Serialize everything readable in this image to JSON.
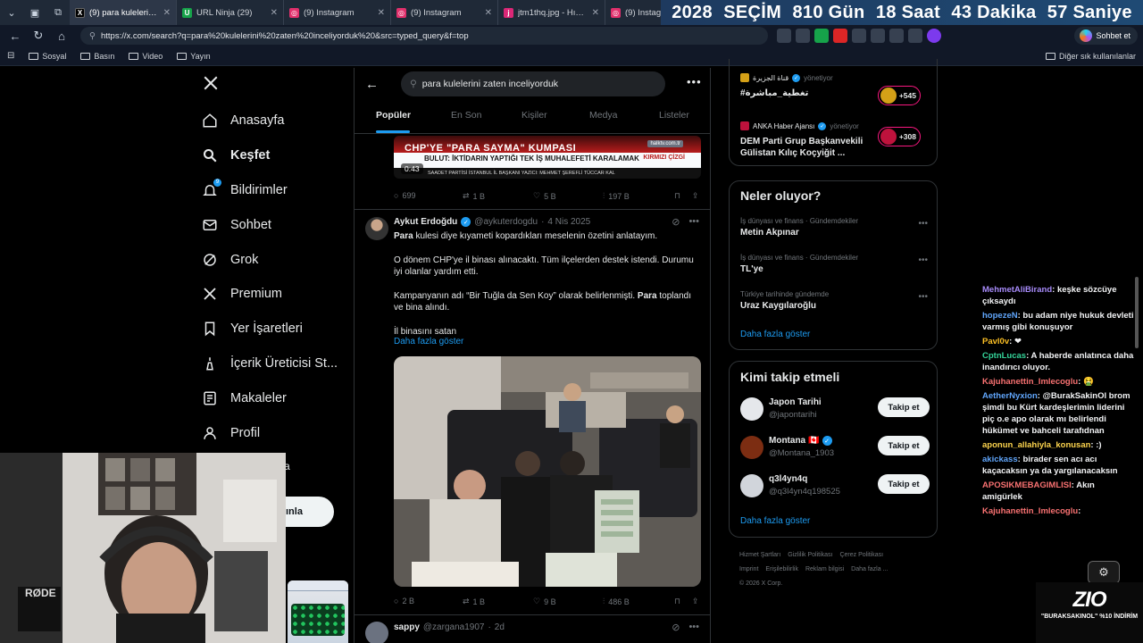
{
  "browser": {
    "tabs": [
      {
        "title": "(9) para kulelerini zaten",
        "color": "#000000",
        "glyph": "X",
        "active": true
      },
      {
        "title": "URL Ninja (29)",
        "color": "#16a34a",
        "glyph": "U",
        "active": false
      },
      {
        "title": "(9) Instagram",
        "color": "#e1306c",
        "glyph": "◎",
        "active": false
      },
      {
        "title": "(9) Instagram",
        "color": "#e1306c",
        "glyph": "◎",
        "active": false
      },
      {
        "title": "jtm1thq.jpg - Hızlı Resim",
        "color": "#db2777",
        "glyph": "j",
        "active": false
      },
      {
        "title": "(9) Instagram",
        "color": "#e1306c",
        "glyph": "◎",
        "active": false
      }
    ],
    "url": "https://x.com/search?q=para%20kulelerini%20zaten%20inceliyorduk%20&src=typed_query&f=top",
    "copilot_label": "Sohbet et",
    "bookmarks": [
      "Sosyal",
      "Basın",
      "Video",
      "Yayın"
    ],
    "other_bookmarks": "Diğer sık kullanılanlar"
  },
  "countdown": [
    "2028",
    "SEÇİM",
    "810 Gün",
    "18 Saat",
    "43 Dakika",
    "57 Saniye"
  ],
  "nav": {
    "items": [
      {
        "label": "Anasayfa",
        "icon": "home-icon",
        "bold": false
      },
      {
        "label": "Keşfet",
        "icon": "search-icon",
        "bold": true
      },
      {
        "label": "Bildirimler",
        "icon": "bell-icon",
        "bold": false
      },
      {
        "label": "Sohbet",
        "icon": "mail-icon",
        "bold": false
      },
      {
        "label": "Grok",
        "icon": "grok-icon",
        "bold": false
      },
      {
        "label": "Premium",
        "icon": "x-premium-icon",
        "bold": false
      },
      {
        "label": "Yer İşaretleri",
        "icon": "bookmark-icon",
        "bold": false
      },
      {
        "label": "İçerik Üreticisi St...",
        "icon": "creator-studio-icon",
        "bold": false
      },
      {
        "label": "Makaleler",
        "icon": "article-icon",
        "bold": false
      },
      {
        "label": "Profil",
        "icon": "profile-icon",
        "bold": false
      }
    ],
    "notification_badge": "9",
    "post_button_partial": "ınla",
    "more_partial": "a"
  },
  "search": {
    "query": "para kulelerini zaten inceliyorduk"
  },
  "tabs": [
    "Popüler",
    "En Son",
    "Kişiler",
    "Medya",
    "Listeler"
  ],
  "news_clip": {
    "headline": "CHP'YE \"PARA SAYMA\" KUMPASI",
    "subline": "BULUT: İKTİDARIN YAPTIĞI TEK İŞ MUHALEFETİ KARALAMAK",
    "tag": "KIRMIZI ÇİZGİ",
    "ticker": "SAADET PARTİSİ İSTANBUL İL BAŞKANI YAZICI: MEHMET ŞEREFLİ TÜCCAR KAL",
    "duration": "0:43"
  },
  "post1_stats": {
    "replies": "699",
    "reposts": "1 B",
    "likes": "5 B",
    "views": "197 B"
  },
  "post2": {
    "name": "Aykut Erdoğdu",
    "handle": "@aykuterdogdu",
    "date": "4 Nis 2025",
    "p1_bold": "Para",
    "p1_rest": " kulesi diye kıyameti kopardıkları meselenin özetini anlatayım.",
    "p2": "O dönem CHP'ye il binası alınacaktı. Tüm ilçelerden destek istendi. Durumu iyi olanlar yardım etti.",
    "p3_start": "Kampanyanın adı “Bir Tuğla da Sen Koy” olarak belirlenmişti. ",
    "p3_bold": "Para",
    "p3_end": " toplandı ve bina alındı.",
    "p4": "İl binasını satan",
    "show_more": "Daha fazla göster",
    "stats": {
      "replies": "2 B",
      "reposts": "1 B",
      "likes": "9 B",
      "views": "486 B"
    }
  },
  "post3": {
    "name": "sappy",
    "handle": "@zargana1907",
    "date": "2d"
  },
  "live": [
    {
      "source": "قناة الجزيرة",
      "verified": true,
      "status": "yönetiyor",
      "title": "#تغطية_مباشرة",
      "count": "+545",
      "avatar_color": "#d4a017"
    },
    {
      "source": "ANKA Haber Ajansı",
      "verified": true,
      "status": "yönetiyor",
      "title": "DEM Parti Grup Başkanvekili Gülistan Kılıç Koçyiğit ...",
      "count": "+308",
      "avatar_color": "#be123c"
    }
  ],
  "trending": {
    "title": "Neler oluyor?",
    "items": [
      {
        "category": "İş dünyası ve finans · Gündemdekiler",
        "title": "Metin Akpınar"
      },
      {
        "category": "İş dünyası ve finans · Gündemdekiler",
        "title": "TL'ye"
      },
      {
        "category": "Türkiye tarihinde gündemde",
        "title": "Uraz Kaygılaroğlu"
      }
    ],
    "show_more": "Daha fazla göster"
  },
  "who_to_follow": {
    "title": "Kimi takip etmeli",
    "users": [
      {
        "name": "Japon Tarihi",
        "handle": "@japontarihi",
        "flag": "",
        "verified": false,
        "avatar_color": "#e5e7eb"
      },
      {
        "name": "Montana",
        "handle": "@Montana_1903",
        "flag": "🇨🇦",
        "verified": true,
        "avatar_color": "#7c2d12"
      },
      {
        "name": "q3l4yn4q",
        "handle": "@q3l4yn4q198525",
        "flag": "",
        "verified": false,
        "avatar_color": "#d1d5db"
      }
    ],
    "follow_label": "Takip et",
    "show_more": "Daha fazla göster"
  },
  "footer": [
    "Hizmet Şartları",
    "Gizlilik Politikası",
    "Çerez Politikası",
    "Imprint",
    "Erişilebilirlik",
    "Reklam bilgisi",
    "Daha fazla ...",
    "© 2026 X Corp."
  ],
  "chat": [
    {
      "user": "MehmetAliBirand",
      "text": "keşke sözcüye çıksaydı",
      "color": "#a78bfa"
    },
    {
      "user": "hopezeN",
      "text": "bu adam niye hukuk devleti varmış gibi konuşuyor",
      "color": "#60a5fa"
    },
    {
      "user": "Pavl0v",
      "text": "❤",
      "color": "#fbbf24"
    },
    {
      "user": "CptnLucas",
      "text": "A haberde anlatınca daha inandırıcı oluyor.",
      "color": "#34d399"
    },
    {
      "user": "Kajuhanettin_Imlecoglu",
      "text": "🤮",
      "color": "#f87171"
    },
    {
      "user": "AetherNyxion",
      "text": "@BurakSakinOl brom şimdi bu Kürt kardeşlerimin liderini piç o.e apo olarak mı belirlendi hükümet ve bahceli tarafıdnan",
      "color": "#60a5fa"
    },
    {
      "user": "aponun_allahiyla_konusan",
      "text": ":)",
      "color": "#fcd34d"
    },
    {
      "user": "akickass",
      "text": "birader sen acı acı kaçacaksın ya da yargılanacaksın",
      "color": "#60a5fa"
    },
    {
      "user": "APOSIKMEBAGIMLISI",
      "text": "Akın amigürlek",
      "color": "#f87171"
    },
    {
      "user": "Kajuhanettin_Imlecoglu",
      "text": "",
      "color": "#f87171"
    }
  ],
  "stream_overlay": {
    "logo": "ZIO",
    "tagline": "\"BURAKSAKINOL\" %10 İNDİRİM",
    "mic_brand": "RØDE"
  }
}
